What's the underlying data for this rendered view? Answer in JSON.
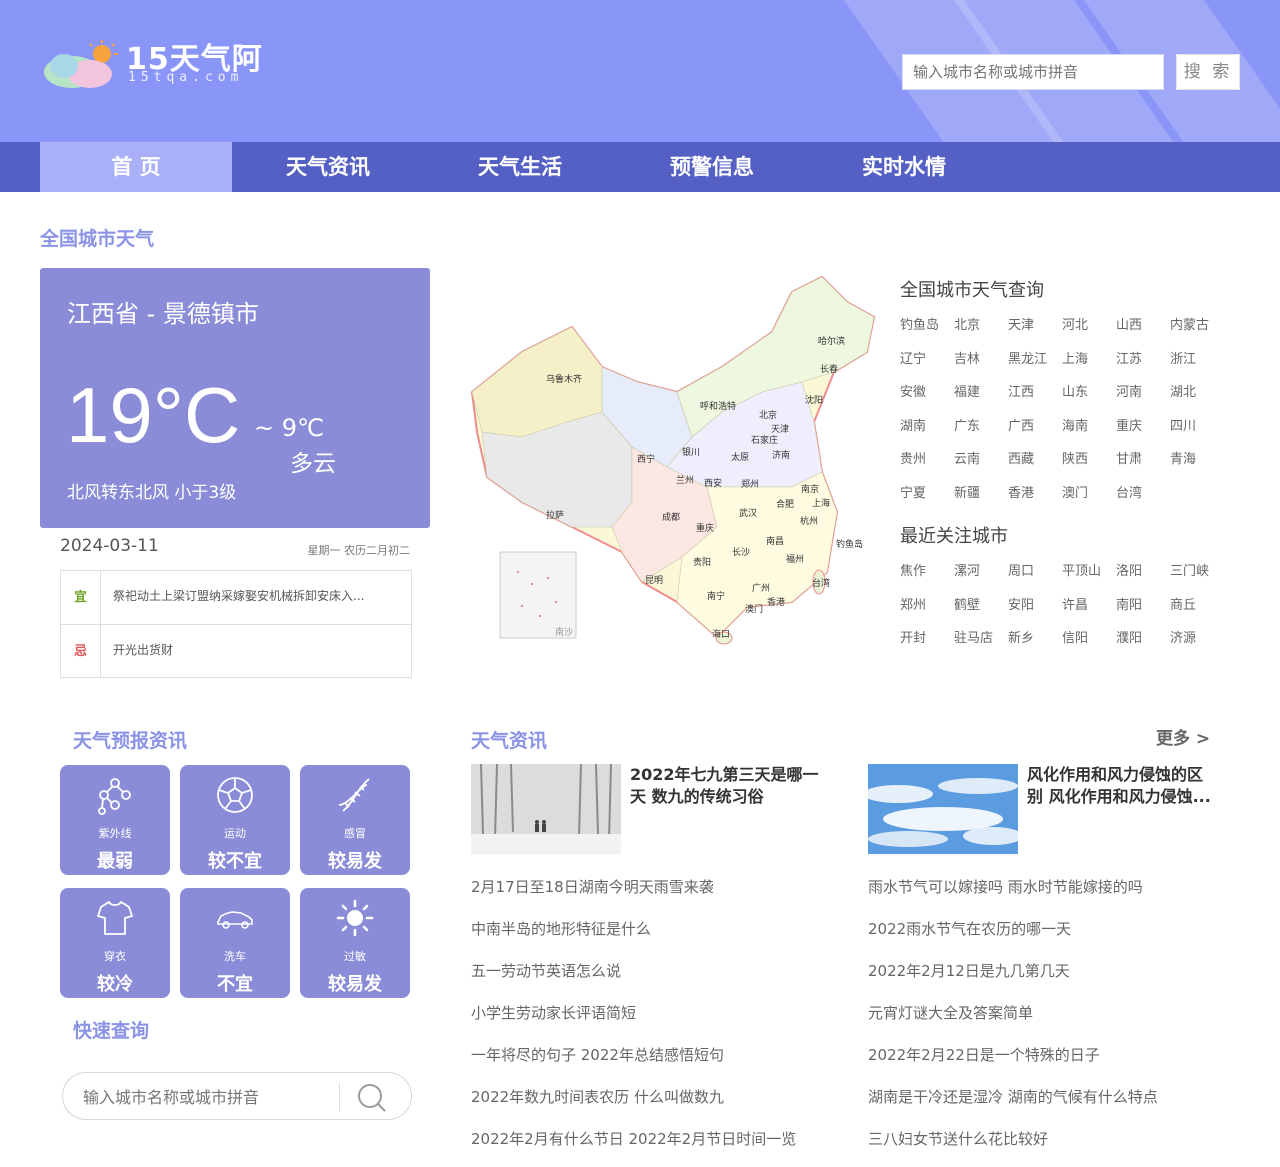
{
  "header": {
    "brand": "15天气阿",
    "domain": "15tqa.com",
    "search_placeholder": "输入城市名称或城市拼音",
    "search_button": "搜 索"
  },
  "nav": {
    "items": [
      "首 页",
      "天气资讯",
      "天气生活",
      "预警信息",
      "实时水情"
    ],
    "active": "首 页"
  },
  "national_section_title": "全国城市天气",
  "weather": {
    "location": "江西省 - 景德镇市",
    "temp_high": "19°C",
    "temp_low": "~ 9℃",
    "condition": "多云",
    "wind": "北风转东北风  小于3级",
    "date": "2024-03-11",
    "lunar": "星期一  农历二月初二",
    "yi_label": "宜",
    "yi_text": "祭祀动土上梁订盟纳采嫁娶安机械拆卸安床入...",
    "ji_label": "忌",
    "ji_text": "开光出货财"
  },
  "map": {
    "labels": [
      "哈尔滨",
      "长春",
      "乌鲁木齐",
      "呼和浩特",
      "沈阳",
      "北京",
      "天津",
      "石家庄",
      "银川",
      "太原",
      "济南",
      "西宁",
      "兰州",
      "西安",
      "郑州",
      "南京",
      "合肥",
      "上海",
      "拉萨",
      "成都",
      "武汉",
      "杭州",
      "钓鱼岛",
      "重庆",
      "南昌",
      "福州",
      "贵阳",
      "长沙",
      "台湾",
      "昆明",
      "广州",
      "南宁",
      "香港",
      "澳门",
      "海口",
      "南沙"
    ]
  },
  "city_query": {
    "title": "全国城市天气查询",
    "cities": [
      "钓鱼岛",
      "北京",
      "天津",
      "河北",
      "山西",
      "内蒙古",
      "辽宁",
      "吉林",
      "黑龙江",
      "上海",
      "江苏",
      "浙江",
      "安徽",
      "福建",
      "江西",
      "山东",
      "河南",
      "湖北",
      "湖南",
      "广东",
      "广西",
      "海南",
      "重庆",
      "四川",
      "贵州",
      "云南",
      "西藏",
      "陕西",
      "甘肃",
      "青海",
      "宁夏",
      "新疆",
      "香港",
      "澳门",
      "台湾"
    ]
  },
  "recent_cities": {
    "title": "最近关注城市",
    "cities": [
      "焦作",
      "漯河",
      "周口",
      "平顶山",
      "洛阳",
      "三门峡",
      "郑州",
      "鹤壁",
      "安阳",
      "许昌",
      "南阳",
      "商丘",
      "开封",
      "驻马店",
      "新乡",
      "信阳",
      "濮阳",
      "济源"
    ]
  },
  "forecast": {
    "title": "天气预报资讯",
    "tiles": [
      {
        "name": "紫外线",
        "value": "最弱",
        "icon": "molecule-icon"
      },
      {
        "name": "运动",
        "value": "较不宜",
        "icon": "football-icon"
      },
      {
        "name": "感冒",
        "value": "较易发",
        "icon": "dna-icon"
      },
      {
        "name": "穿衣",
        "value": "较冷",
        "icon": "tshirt-icon"
      },
      {
        "name": "洗车",
        "value": "不宜",
        "icon": "car-icon"
      },
      {
        "name": "过敏",
        "value": "较易发",
        "icon": "sun-icon"
      }
    ]
  },
  "quick": {
    "title": "快速查询",
    "placeholder": "输入城市名称或城市拼音"
  },
  "news": {
    "title": "天气资讯",
    "more": "更多 >",
    "featured": [
      {
        "title": "2022年七九第三天是哪一天 数九的传统习俗"
      },
      {
        "title": "风化作用和风力侵蚀的区别 风化作用和风力侵蚀..."
      }
    ],
    "left": [
      "2月17日至18日湖南今明天雨雪来袭",
      "中南半岛的地形特征是什么",
      "五一劳动节英语怎么说",
      "小学生劳动家长评语简短",
      "一年将尽的句子 2022年总结感悟短句",
      "2022年数九时间表农历 什么叫做数九",
      "2022年2月有什么节日 2022年2月节日时间一览"
    ],
    "right": [
      "雨水节气可以嫁接吗 雨水时节能嫁接的吗",
      "2022雨水节气在农历的哪一天",
      "2022年2月12日是九几第几天",
      "元宵灯谜大全及答案简单",
      "2022年2月22日是一个特殊的日子",
      "湖南是干冷还是湿冷 湖南的气候有什么特点",
      "三八妇女节送什么花比较好"
    ]
  }
}
